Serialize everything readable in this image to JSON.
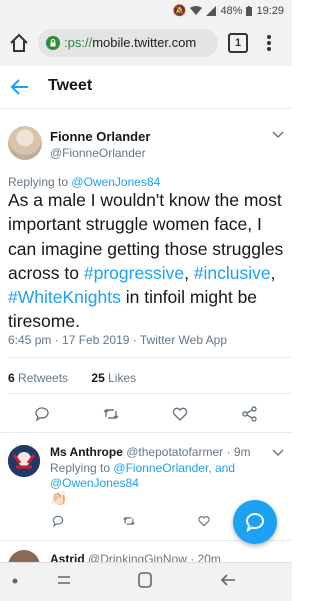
{
  "status_bar": {
    "battery": "48%",
    "time": "19:29"
  },
  "browser": {
    "url_prefix": ":ps://",
    "url_host": "mobile.twitter.com",
    "tab_count": "1"
  },
  "header": {
    "title": "Tweet"
  },
  "tweet": {
    "name": "Fionne Orlander",
    "handle": "@FionneOrlander",
    "replying_prefix": "Replying to",
    "replying_to": "@OwenJones84",
    "text_part1": "As a male I wouldn't know the most important struggle women face, I can imagine getting those struggles across to",
    "hashtag1": "#progressive",
    "hashtag2": "#inclusive",
    "hashtag3": "#WhiteKnights",
    "text_part2": "in tinfoil might be tiresome.",
    "meta": "6:45 pm · 17 Feb 2019 · Twitter Web App",
    "retweets_count": "6",
    "retweets_label": "Retweets",
    "likes_count": "25",
    "likes_label": "Likes"
  },
  "reply": {
    "name": "Ms Anthrope",
    "handle": "@thepotatofarmer",
    "time": "· 9m",
    "replying_prefix": "Replying to",
    "replying_to_1": "@FionneOrlander",
    "replying_and": ", and",
    "replying_to_2": "@OwenJones84",
    "emoji": "👏🏻"
  },
  "next_reply": {
    "name": "Astrid",
    "handle": "@DrinkingGinNow",
    "time": "· 20m"
  },
  "colors": {
    "accent": "#1da1f2",
    "muted": "#657786",
    "text": "#14171a"
  }
}
